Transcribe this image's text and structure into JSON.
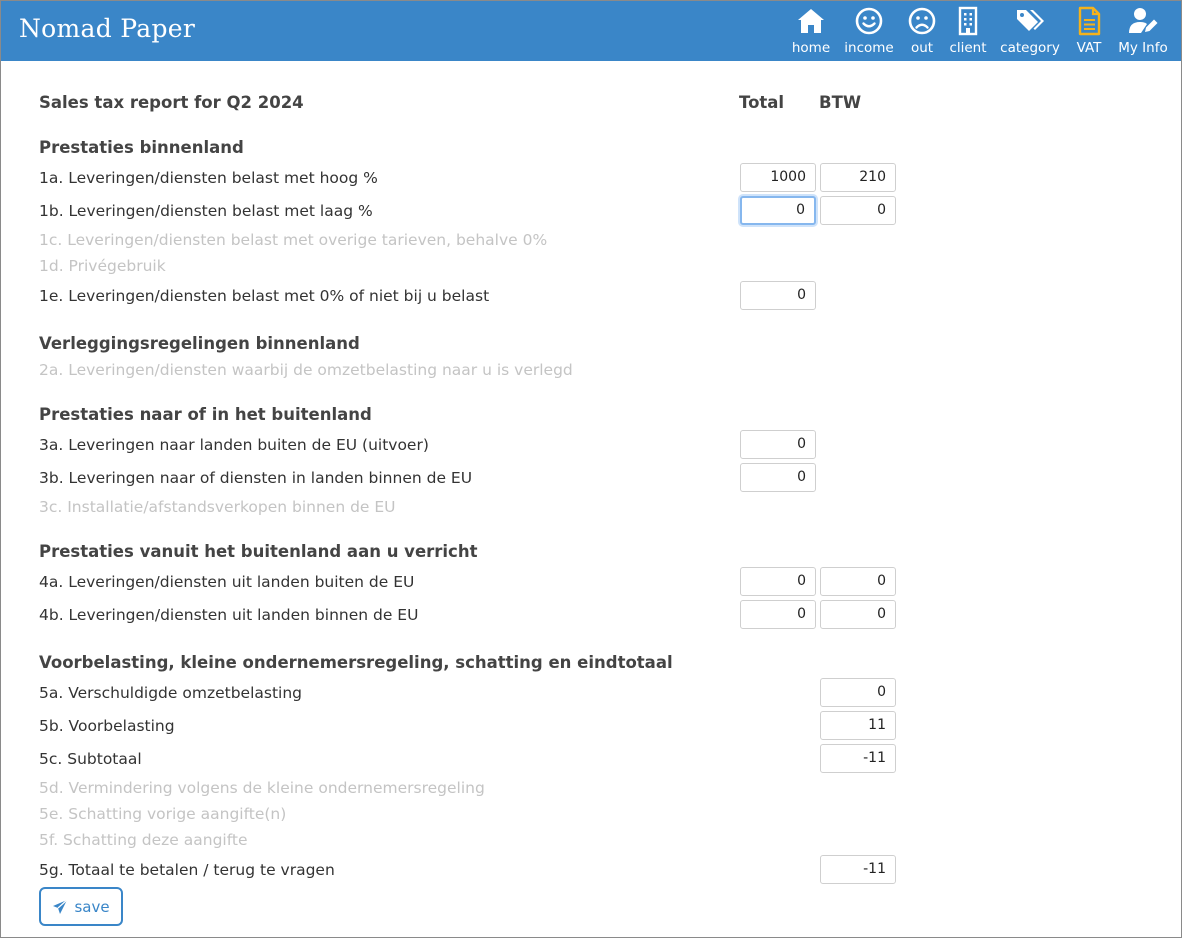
{
  "app": {
    "title": "Nomad Paper"
  },
  "nav": {
    "home": "home",
    "income": "income",
    "out": "out",
    "client": "client",
    "category": "category",
    "vat": "VAT",
    "myinfo": "My Info"
  },
  "colors": {
    "navbar": "#3a86c8",
    "active_nav": "#f5b21b",
    "disabled_text": "#c4c4c4"
  },
  "report": {
    "title": "Sales tax report for Q2 2024",
    "col_total": "Total",
    "col_btw": "BTW",
    "s1": {
      "heading": "Prestaties binnenland",
      "r1a": {
        "label": "1a. Leveringen/diensten belast met hoog %",
        "total": "1000",
        "btw": "210"
      },
      "r1b": {
        "label": "1b. Leveringen/diensten belast met laag %",
        "total": "0",
        "btw": "0"
      },
      "r1c": {
        "label": "1c. Leveringen/diensten belast met overige tarieven, behalve 0%"
      },
      "r1d": {
        "label": "1d. Privégebruik"
      },
      "r1e": {
        "label": "1e. Leveringen/diensten belast met 0% of niet bij u belast",
        "total": "0"
      }
    },
    "s2": {
      "heading": "Verleggingsregelingen binnenland",
      "r2a": {
        "label": "2a. Leveringen/diensten waarbij de omzetbelasting naar u is verlegd"
      }
    },
    "s3": {
      "heading": "Prestaties naar of in het buitenland",
      "r3a": {
        "label": "3a. Leveringen naar landen buiten de EU (uitvoer)",
        "total": "0"
      },
      "r3b": {
        "label": "3b. Leveringen naar of diensten in landen binnen de EU",
        "total": "0"
      },
      "r3c": {
        "label": "3c. Installatie/afstandsverkopen binnen de EU"
      }
    },
    "s4": {
      "heading": "Prestaties vanuit het buitenland aan u verricht",
      "r4a": {
        "label": "4a. Leveringen/diensten uit landen buiten de EU",
        "total": "0",
        "btw": "0"
      },
      "r4b": {
        "label": "4b. Leveringen/diensten uit landen binnen de EU",
        "total": "0",
        "btw": "0"
      }
    },
    "s5": {
      "heading": "Voorbelasting, kleine ondernemersregeling, schatting en eindtotaal",
      "r5a": {
        "label": "5a. Verschuldigde omzetbelasting",
        "btw": "0"
      },
      "r5b": {
        "label": "5b. Voorbelasting",
        "btw": "11"
      },
      "r5c": {
        "label": "5c. Subtotaal",
        "btw": "-11"
      },
      "r5d": {
        "label": "5d. Vermindering volgens de kleine ondernemersregeling"
      },
      "r5e": {
        "label": "5e. Schatting vorige aangifte(n)"
      },
      "r5f": {
        "label": "5f. Schatting deze aangifte"
      },
      "r5g": {
        "label": "5g. Totaal te betalen / terug te vragen",
        "btw": "-11"
      }
    }
  },
  "actions": {
    "save_label": "save"
  }
}
